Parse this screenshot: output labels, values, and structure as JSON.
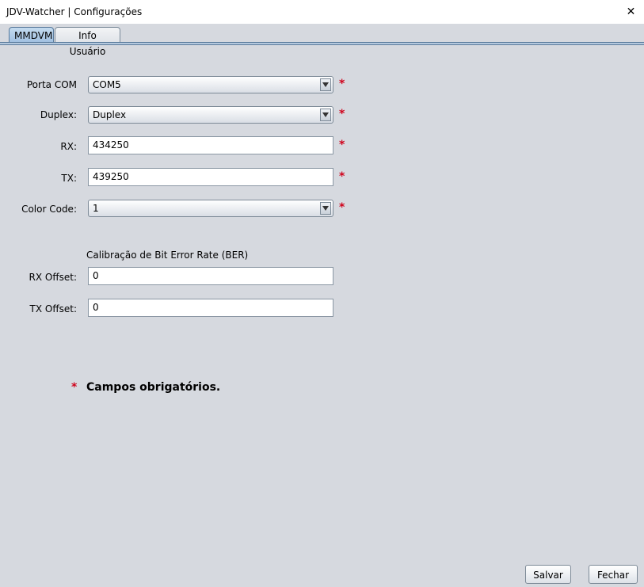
{
  "window": {
    "title": "JDV-Watcher | Configurações",
    "close_symbol": "✕"
  },
  "tabs": [
    {
      "label": "MMDVM",
      "active": true
    },
    {
      "label": "Info Usuário",
      "active": false
    }
  ],
  "form": {
    "porta_com": {
      "label": "Porta COM",
      "value": "COM5",
      "required": "*"
    },
    "duplex": {
      "label": "Duplex:",
      "value": "Duplex",
      "required": "*"
    },
    "rx": {
      "label": "RX:",
      "value": "434250",
      "required": "*"
    },
    "tx": {
      "label": "TX:",
      "value": "439250",
      "required": "*"
    },
    "color_code": {
      "label": "Color Code:",
      "value": "1",
      "required": "*"
    },
    "ber_section_title": "Calibração de Bit Error Rate (BER)",
    "rx_offset": {
      "label": "RX Offset:",
      "value": "0"
    },
    "tx_offset": {
      "label": "TX Offset:",
      "value": "0"
    }
  },
  "note": {
    "star": "*",
    "text": "Campos obrigatórios."
  },
  "buttons": {
    "save": "Salvar",
    "close": "Fechar"
  },
  "colors": {
    "required": "#d0021b",
    "background": "#d6d9df",
    "active_tab": "#b5c9de"
  }
}
